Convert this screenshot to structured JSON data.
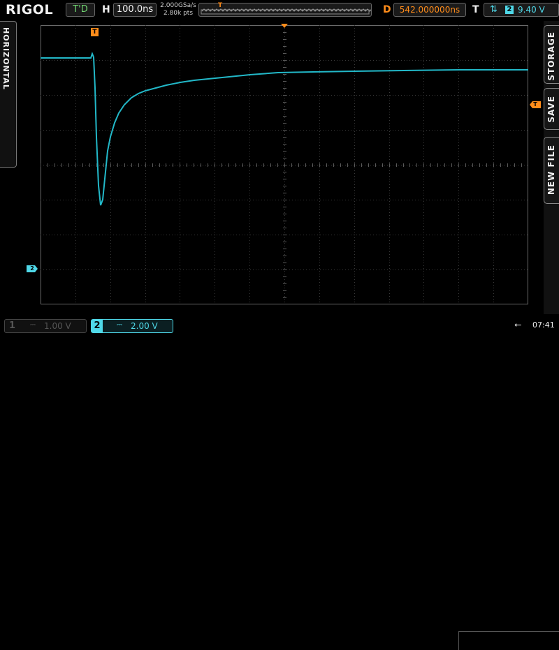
{
  "header": {
    "logo": "RIGOL",
    "run_state": "T'D",
    "h_label": "H",
    "timebase": "100.0ns",
    "sample_rate": "2.000GSa/s",
    "memory_depth": "2.80k pts",
    "delay_label": "D",
    "delay": "542.000000ns",
    "trigger_label": "T",
    "trigger_source": "2",
    "trigger_level": "9.40 V"
  },
  "left_menu": {
    "horizontal": "HORIZONTAL"
  },
  "right_menu": {
    "storage": "STORAGE",
    "save": "SAVE",
    "new_file": "NEW FILE"
  },
  "markers": {
    "trigger_position": "T",
    "trigger_level": "T",
    "channel2_ground": "2"
  },
  "channels": [
    {
      "number": "1",
      "coupling": "⎓",
      "scale": "1.00 V",
      "active": false
    },
    {
      "number": "2",
      "coupling": "⎓",
      "scale": "2.00 V",
      "active": true
    }
  ],
  "status": {
    "usb_icon": "usb-icon",
    "time": "07:41"
  },
  "colors": {
    "ch2": "#4fd8e8",
    "trigger": "#ff8c1a",
    "grid": "#3a3a3a"
  }
}
